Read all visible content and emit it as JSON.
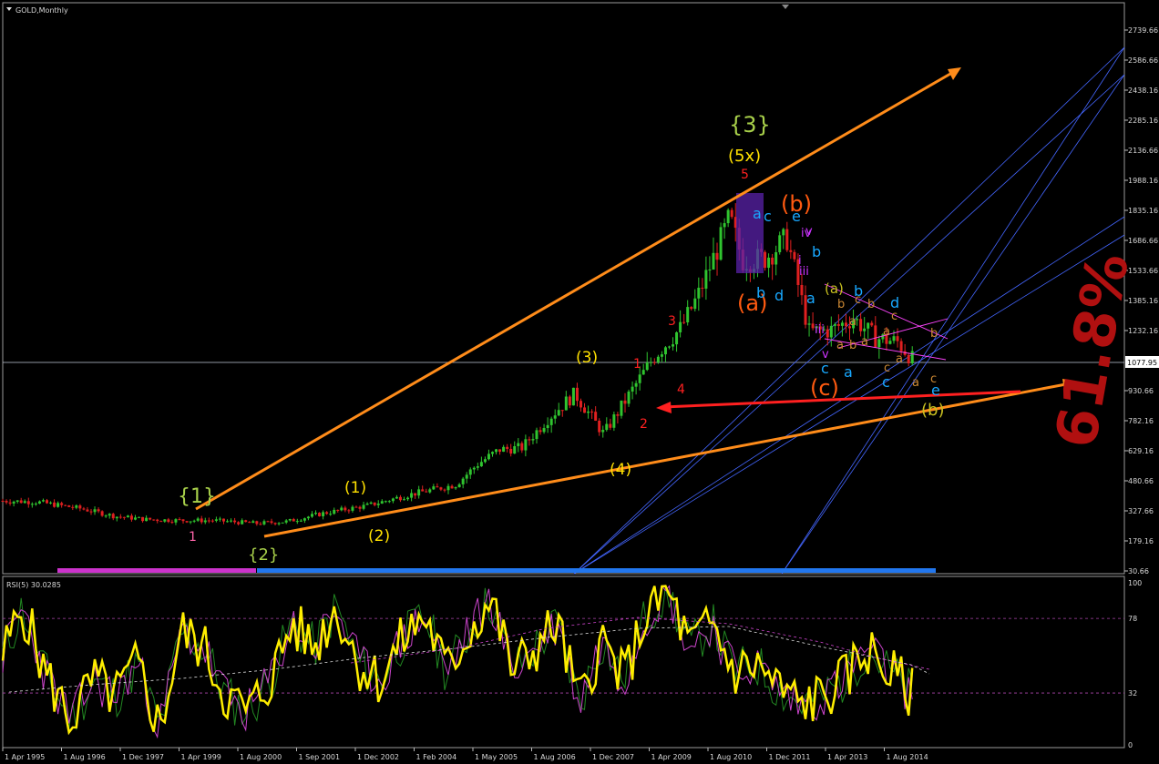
{
  "main_title": "GOLD,Monthly",
  "rsi_title": "RSI(5) 30.0285",
  "current_price": "1077.95",
  "price_ticks": [
    "2739.66",
    "2586.66",
    "2438.16",
    "2285.16",
    "2136.66",
    "1988.16",
    "1835.16",
    "1686.66",
    "1533.66",
    "1385.16",
    "1232.16",
    "1077.95",
    "930.66",
    "782.16",
    "629.16",
    "480.66",
    "327.66",
    "179.16",
    "30.66"
  ],
  "rsi_ticks": [
    "100",
    "78",
    "32",
    "0"
  ],
  "date_ticks": [
    "1 Apr 1995",
    "1 Aug 1996",
    "1 Dec 1997",
    "1 Apr 1999",
    "1 Aug 2000",
    "1 Sep 2001",
    "1 Dec 2002",
    "1 Feb 2004",
    "1 May 2005",
    "1 Aug 2006",
    "1 Dec 2007",
    "1 Apr 2009",
    "1 Aug 2010",
    "1 Dec 2011",
    "1 Apr 2013",
    "1 Aug 2014"
  ],
  "watermark": "61.8%",
  "colors": {
    "background": "#000000",
    "bull_candle": "#2fc42f",
    "bear_candle": "#e02020",
    "trendline": "#ff8c1a",
    "fib_fan": "#4466ff",
    "rsi_line": "#ffee00",
    "rsi_signal": "#cc44cc",
    "rsi_smooth": "#228822",
    "watermark": "#b01010"
  },
  "chart_data": {
    "type": "candlestick",
    "price_axis": [
      30.66,
      2739.66
    ],
    "rsi_axis": [
      0,
      100
    ],
    "rsi_levels": [
      78,
      32
    ],
    "series": [
      {
        "name": "GOLD",
        "x": [
          1995.25,
          1996.0,
          1997.0,
          1997.8,
          1998.5,
          1999.25,
          2000.0,
          2001.0,
          2001.7,
          2002.5,
          2003.5,
          2004.5,
          2005.5,
          2006.0,
          2006.5,
          2007.0,
          2007.6,
          2008.2,
          2008.85,
          2009.5,
          2010.0,
          2010.6,
          2011.0,
          2011.7,
          2012.0,
          2012.5,
          2013.0,
          2013.5,
          2014.0,
          2014.5,
          2015.0,
          2015.5,
          2015.9
        ],
        "values": [
          385,
          380,
          345,
          305,
          290,
          285,
          285,
          270,
          280,
          320,
          360,
          420,
          470,
          570,
          640,
          650,
          800,
          920,
          720,
          940,
          1110,
          1250,
          1420,
          1800,
          1590,
          1600,
          1700,
          1230,
          1240,
          1300,
          1200,
          1180,
          1077
        ]
      },
      {
        "name": "RSI(5)",
        "x": [
          1995.25,
          1995.7,
          1996.2,
          1996.8,
          1997.3,
          1997.8,
          1998.3,
          1998.8,
          1999.3,
          1999.8,
          2000.3,
          2000.8,
          2001.3,
          2001.8,
          2002.3,
          2002.8,
          2003.3,
          2003.8,
          2004.3,
          2004.8,
          2005.3,
          2005.8,
          2006.3,
          2006.8,
          2007.3,
          2007.8,
          2008.3,
          2008.8,
          2009.3,
          2009.8,
          2010.3,
          2010.8,
          2011.3,
          2011.8,
          2012.3,
          2012.8,
          2013.3,
          2013.8,
          2014.3,
          2014.8,
          2015.3,
          2015.9
        ],
        "values": [
          55,
          85,
          45,
          15,
          40,
          30,
          50,
          10,
          70,
          60,
          30,
          20,
          40,
          75,
          60,
          85,
          50,
          40,
          65,
          80,
          45,
          70,
          90,
          45,
          60,
          75,
          25,
          65,
          40,
          80,
          95,
          60,
          75,
          45,
          50,
          35,
          25,
          30,
          40,
          60,
          45,
          30
        ]
      }
    ]
  },
  "wave_labels": [
    {
      "text": "{1}",
      "color": "#a8d04a"
    },
    {
      "text": "{2}",
      "color": "#a8d04a"
    },
    {
      "text": "{3}",
      "color": "#a8d04a"
    },
    {
      "text": "(1)",
      "color": "#ffe000"
    },
    {
      "text": "(2)",
      "color": "#ffe000"
    },
    {
      "text": "(3)",
      "color": "#ffe000"
    },
    {
      "text": "(4)",
      "color": "#ffe000"
    },
    {
      "text": "(5x)",
      "color": "#ffe000"
    },
    {
      "text": "(a)",
      "color": "#ff5a10"
    },
    {
      "text": "(b)",
      "color": "#ff5a10"
    },
    {
      "text": "(c)",
      "color": "#ff5a10"
    },
    {
      "text": "(b)",
      "color": "#c8c020"
    },
    {
      "text": "(a)",
      "color": "#c8c020"
    },
    {
      "text": "1",
      "color": "#ff2020"
    },
    {
      "text": "2",
      "color": "#ff2020"
    },
    {
      "text": "3",
      "color": "#ff2020"
    },
    {
      "text": "4",
      "color": "#ff2020"
    },
    {
      "text": "5",
      "color": "#ff2020"
    },
    {
      "text": "a",
      "color": "#18a8ff"
    },
    {
      "text": "b",
      "color": "#18a8ff"
    },
    {
      "text": "c",
      "color": "#18a8ff"
    },
    {
      "text": "d",
      "color": "#18a8ff"
    },
    {
      "text": "e",
      "color": "#18a8ff"
    },
    {
      "text": "b",
      "color": "#18a8ff"
    },
    {
      "text": "d",
      "color": "#18a8ff"
    },
    {
      "text": "a",
      "color": "#18a8ff"
    },
    {
      "text": "c",
      "color": "#18a8ff"
    },
    {
      "text": "b",
      "color": "#18a8ff"
    },
    {
      "text": "a",
      "color": "#18a8ff"
    },
    {
      "text": "c",
      "color": "#18a8ff"
    },
    {
      "text": "e",
      "color": "#18a8ff"
    },
    {
      "text": "iii",
      "color": "#cc33ff"
    },
    {
      "text": "iv",
      "color": "#cc33ff"
    },
    {
      "text": "v",
      "color": "#cc33ff"
    },
    {
      "text": "iii",
      "color": "#cc33ff"
    },
    {
      "text": "v",
      "color": "#cc33ff"
    },
    {
      "text": "i",
      "color": "#cc33ff"
    },
    {
      "text": "1",
      "color": "#ff66aa"
    },
    {
      "text": "a",
      "color": "#cc8833"
    },
    {
      "text": "b",
      "color": "#cc8833"
    },
    {
      "text": "a",
      "color": "#cc8833"
    },
    {
      "text": "c",
      "color": "#cc8833"
    },
    {
      "text": "b",
      "color": "#cc8833"
    },
    {
      "text": "a",
      "color": "#cc8833"
    },
    {
      "text": "a",
      "color": "#cc8833"
    },
    {
      "text": "c",
      "color": "#cc8833"
    },
    {
      "text": "b",
      "color": "#cc8833"
    },
    {
      "text": "a",
      "color": "#cc8833"
    },
    {
      "text": "c",
      "color": "#cc8833"
    },
    {
      "text": "b",
      "color": "#cc8833"
    },
    {
      "text": "a",
      "color": "#cc8833"
    },
    {
      "text": "c",
      "color": "#cc8833"
    }
  ]
}
